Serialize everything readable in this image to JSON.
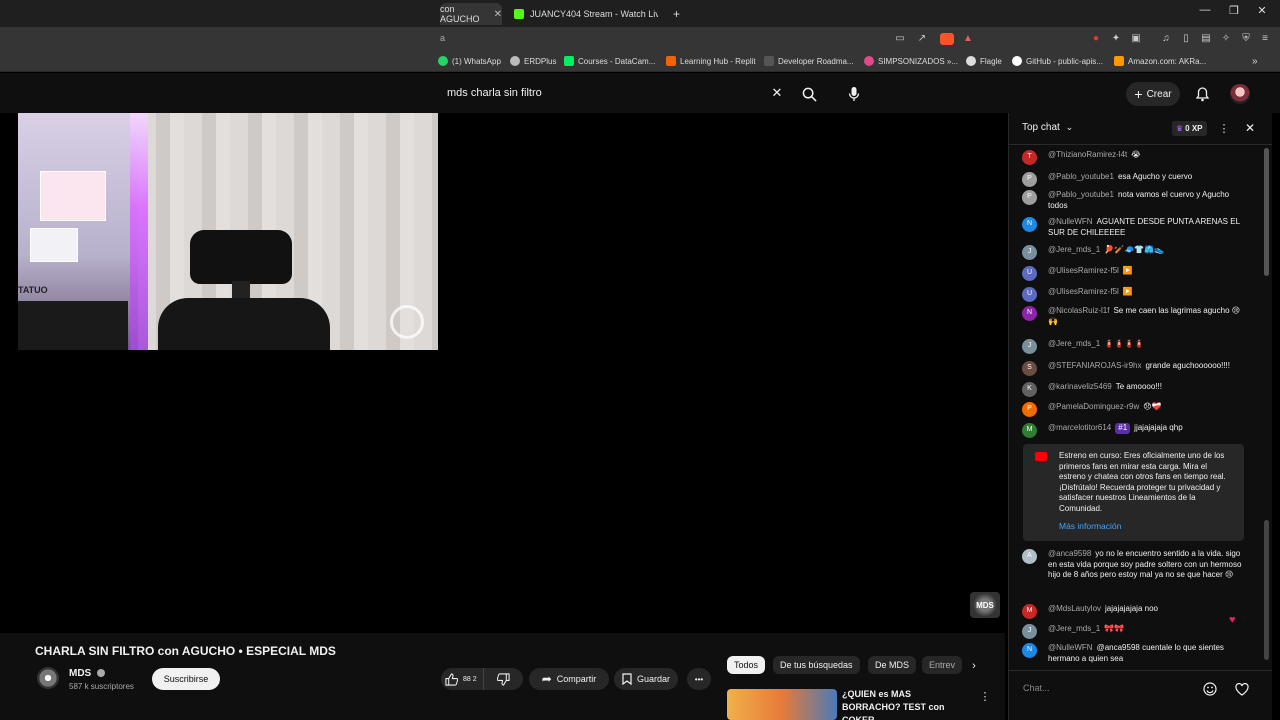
{
  "browser": {
    "tabs": [
      {
        "label": "con AGUCHO",
        "active": true
      },
      {
        "label": "JUANCY404 Stream - Watch Live on K",
        "active": false
      }
    ],
    "new_tab_label": "+",
    "window_controls": [
      "—",
      "❐",
      "✕"
    ],
    "url_fragment": "a",
    "bookmarks": [
      {
        "label": "(1) WhatsApp",
        "color": "#25d366"
      },
      {
        "label": "ERDPlus",
        "color": "#bbbbbb"
      },
      {
        "label": "Courses - DataCam...",
        "color": "#03ef62"
      },
      {
        "label": "Learning Hub - Replit",
        "color": "#f26207"
      },
      {
        "label": "Developer Roadma...",
        "color": "#222222"
      },
      {
        "label": "SIMPSONIZADOS »...",
        "color": "#e04a8a"
      },
      {
        "label": "Flagle",
        "color": "#dddddd"
      },
      {
        "label": "GitHub - public-apis...",
        "color": "#ffffff"
      },
      {
        "label": "Amazon.com: AKRa...",
        "color": "#ff9900"
      }
    ]
  },
  "header": {
    "search_value": "mds charla sin filtro",
    "create_label": "Crear"
  },
  "webcam": {
    "sign_text": "TATUO"
  },
  "player": {
    "watermark": "MDS"
  },
  "video": {
    "title": "CHARLA SIN FILTRO con AGUCHO • ESPECIAL MDS",
    "channel": "MDS",
    "subscribers": "587 k suscriptores",
    "subscribe_label": "Suscribirse",
    "likes": "88 2",
    "share_label": "Compartir",
    "save_label": "Guardar",
    "more_label": "•••"
  },
  "chips": [
    "Todos",
    "De tus búsquedas",
    "De MDS",
    "Entrev"
  ],
  "recommended": {
    "title": "¿QUIEN es MAS BORRACHO? TEST con COKER"
  },
  "chat": {
    "mode_label": "Top chat",
    "xp_label": "0 XP",
    "messages": [
      {
        "author": "@ThizianoRamirez-l4t",
        "text": "😭",
        "initial": "T",
        "color": "#c62828"
      },
      {
        "author": "@Pablo_youtube1",
        "text": "esa Agucho y cuervo",
        "initial": "P",
        "color": "#9e9e9e"
      },
      {
        "author": "@Pablo_youtube1",
        "text": "nota vamos el cuervo y Agucho todos",
        "initial": "P",
        "color": "#9e9e9e"
      },
      {
        "author": "@NulleWFN",
        "text": "AGUANTE DESDE PUNTA ARENAS EL SUR DE CHILEEEEE",
        "initial": "N",
        "color": "#1e88e5"
      },
      {
        "author": "@Jere_mds_1",
        "text": "🏓🏏🧢👕🩳👟",
        "initial": "J",
        "color": "#78909c"
      },
      {
        "author": "@UlisesRamirez-f5l",
        "text": "▶️",
        "initial": "U",
        "color": "#5c6bc0"
      },
      {
        "author": "@UlisesRamirez-f5l",
        "text": "▶️",
        "initial": "U",
        "color": "#5c6bc0"
      },
      {
        "author": "@NicolasRuiz-l1f",
        "text": "Se me caen las lagrimas agucho 😢🙌",
        "initial": "N",
        "color": "#8e24aa"
      },
      {
        "author": "@Jere_mds_1",
        "text": "🧯🧯🧯🧯",
        "initial": "J",
        "color": "#78909c"
      },
      {
        "author": "@STEFANIAROJAS-ir9hx",
        "text": "grande aguchoooooo!!!!",
        "initial": "S",
        "color": "#6d4c41"
      },
      {
        "author": "@karinaveliz5469",
        "text": "Te amoooo!!!",
        "initial": "K",
        "color": "#616161"
      },
      {
        "author": "@PamelaDominguez-r9w",
        "text": "😞❤️‍🩹",
        "initial": "P",
        "color": "#ef6c00"
      },
      {
        "author": "@marcelotitor614",
        "badge": "#1",
        "text": "jjajajajaja qhp",
        "initial": "M",
        "color": "#2e7d32"
      }
    ],
    "notice": {
      "text": "Estreno en curso: Eres oficialmente uno de los primeros fans en mirar esta carga. Mira el estreno y chatea con otros fans en tiempo real. ¡Disfrútalo! Recuerda proteger tu privacidad y satisfacer nuestros Lineamientos de la Comunidad.",
      "link": "Más información"
    },
    "messages_after": [
      {
        "author": "@anca9598",
        "text": "yo no le encuentro sentido a la vida. sigo en esta vida porque soy padre soltero con un hermoso hijo de 8 años pero estoy mal ya no se que hacer 😢",
        "initial": "A",
        "color": "#b0bec5"
      },
      {
        "author": "@MdsLautylov",
        "text": "jajajajajaja noo",
        "initial": "M",
        "color": "#c62828"
      },
      {
        "author": "@Jere_mds_1",
        "text": "🎀🎀",
        "initial": "J",
        "color": "#78909c"
      },
      {
        "author": "@NulleWFN",
        "text": "@anca9598 cuentale lo que sientes hermano a quien sea",
        "initial": "N",
        "color": "#1e88e5"
      }
    ],
    "input_placeholder": "Chat..."
  }
}
